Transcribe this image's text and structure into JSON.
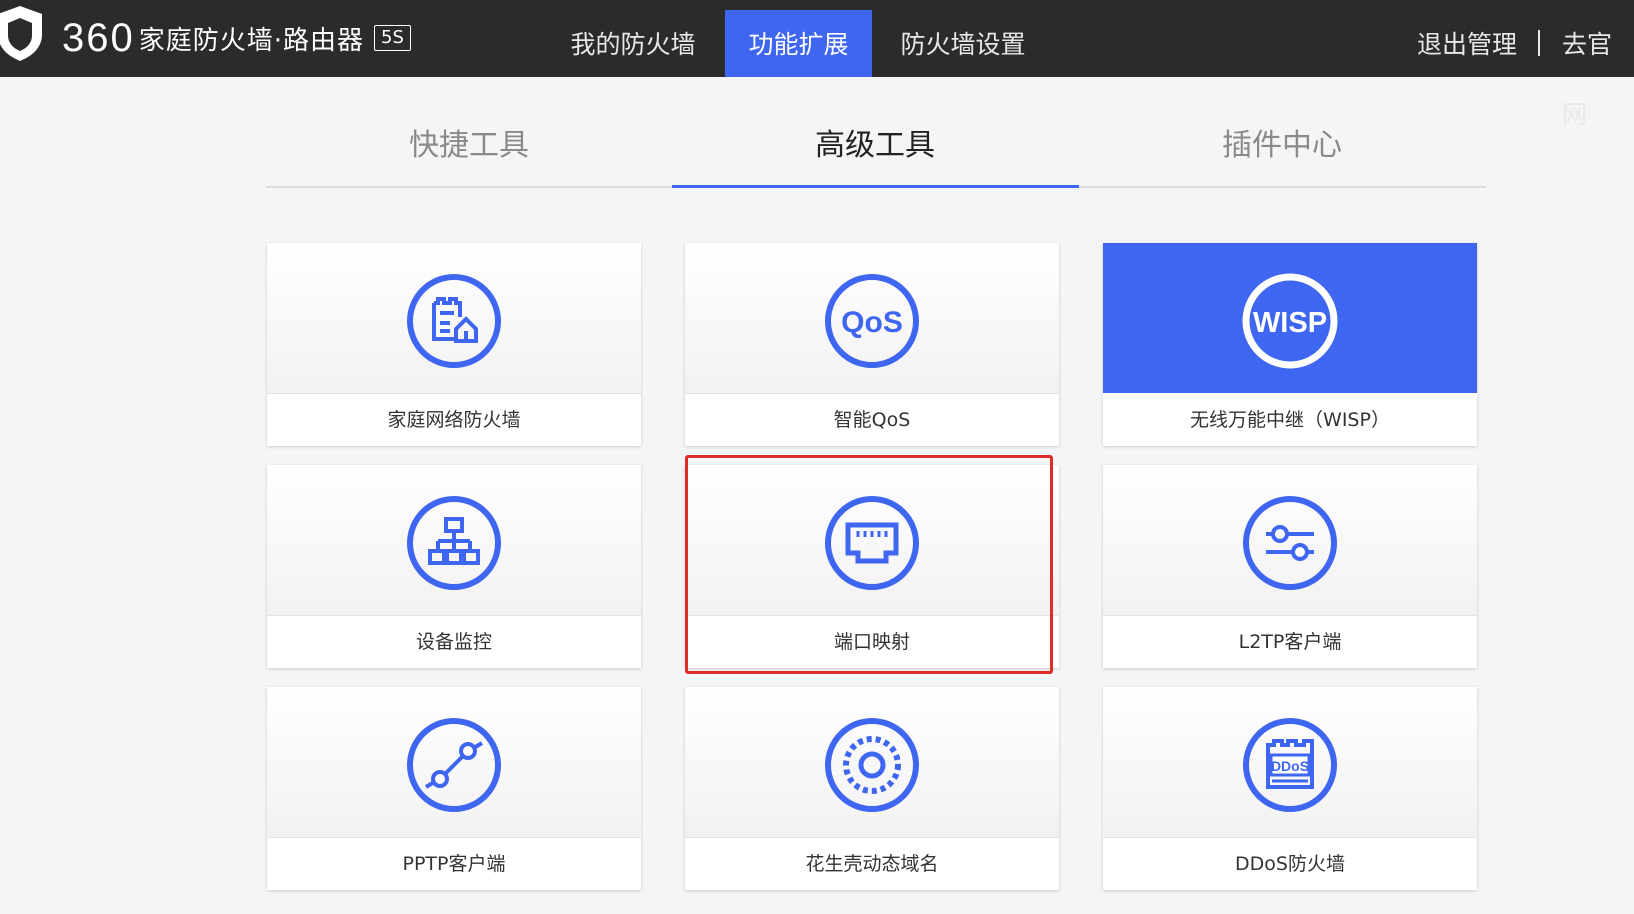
{
  "header": {
    "brand_number": "360",
    "brand_text": "家庭防火墙·路由器",
    "brand_badge": "5S",
    "nav": [
      {
        "label": "我的防火墙",
        "active": false
      },
      {
        "label": "功能扩展",
        "active": true
      },
      {
        "label": "防火墙设置",
        "active": false
      }
    ],
    "logout_label": "退出管理",
    "divider_text": "|",
    "official_site_label": "去官网"
  },
  "tabs": [
    {
      "label": "快捷工具",
      "active": false
    },
    {
      "label": "高级工具",
      "active": true
    },
    {
      "label": "插件中心",
      "active": false
    }
  ],
  "tools": [
    {
      "label": "家庭网络防火墙",
      "icon": "home-firewall-icon"
    },
    {
      "label": "智能QoS",
      "icon": "qos-icon",
      "icon_text": "QoS"
    },
    {
      "label": "无线万能中继（WISP）",
      "icon": "wisp-icon",
      "icon_text": "WISP",
      "selected": true
    },
    {
      "label": "设备监控",
      "icon": "device-network-icon"
    },
    {
      "label": "端口映射",
      "icon": "ethernet-port-icon",
      "highlighted": true
    },
    {
      "label": "L2TP客户端",
      "icon": "sliders-icon"
    },
    {
      "label": "PPTP客户端",
      "icon": "link-nodes-icon"
    },
    {
      "label": "花生壳动态域名",
      "icon": "dotted-ring-icon"
    },
    {
      "label": "DDoS防火墙",
      "icon": "ddos-firewall-icon",
      "icon_text": "DDoS"
    }
  ],
  "colors": {
    "accent": "#3e66f0",
    "topbar": "#2b2b2b",
    "highlight_border": "#e12b25"
  }
}
